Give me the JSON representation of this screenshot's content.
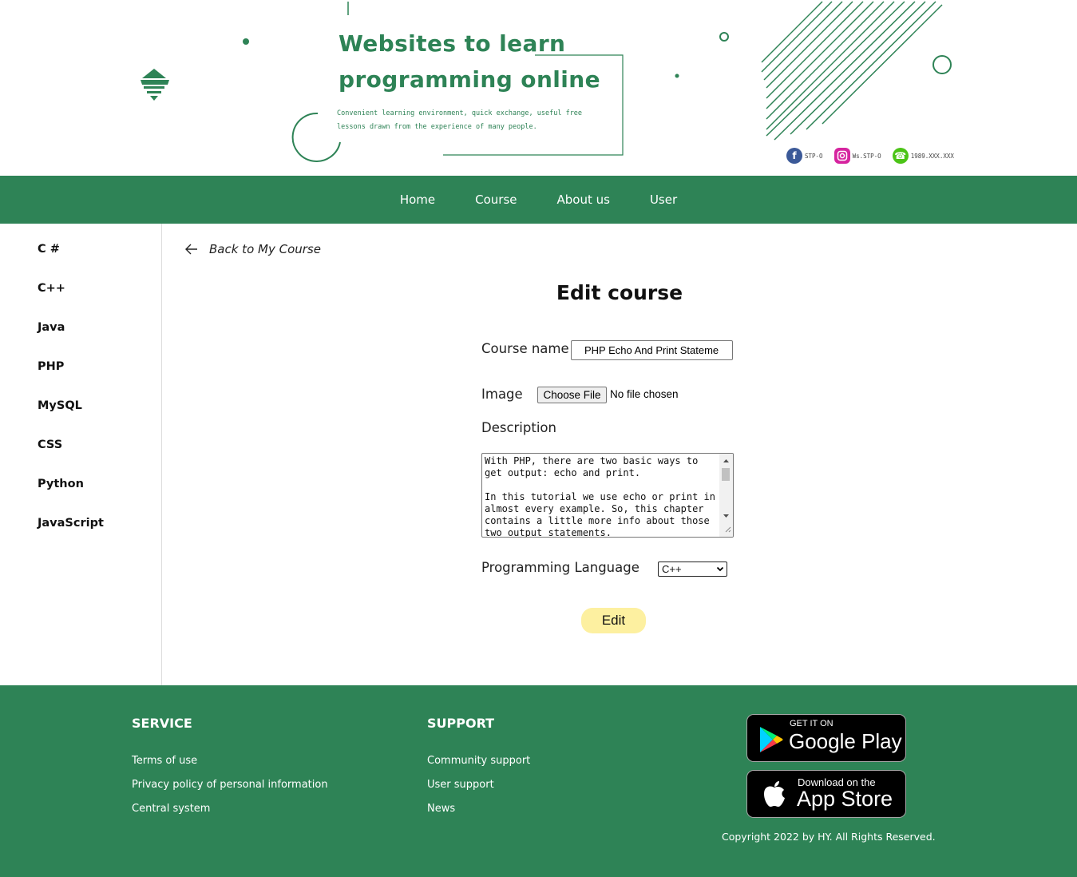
{
  "header": {
    "title_line1": "Websites to learn",
    "title_line2": "programming online",
    "subtitle": "Convenient learning environment, quick exchange, useful free lessons drawn from the experience of many people.",
    "socials": [
      {
        "icon": "facebook-icon",
        "text": "STP-O",
        "color": "#3b5998"
      },
      {
        "icon": "instagram-icon",
        "text": "Ws.STP-O",
        "color": "#d6249f"
      },
      {
        "icon": "phone-icon",
        "text": "1989.XXX.XXX",
        "color": "#4cc417"
      }
    ]
  },
  "nav": {
    "items": [
      "Home",
      "Course",
      "About us",
      "User"
    ]
  },
  "sidebar": {
    "items": [
      "C #",
      "C++",
      "Java",
      "PHP",
      "MySQL",
      "CSS",
      "Python",
      "JavaScript"
    ]
  },
  "main": {
    "back_label": "Back to My Course",
    "title": "Edit course",
    "course_name_label": "Course name",
    "course_name_value": "PHP Echo And Print Stateme",
    "image_label": "Image",
    "file_button": "Choose File",
    "file_status": "No file chosen",
    "description_label": "Description",
    "description_value": "With PHP, there are two basic ways to get output: echo and print.\n\nIn this tutorial we use echo or print in almost every example. So, this chapter contains a little more info about those two output statements.",
    "language_label": "Programming Language",
    "language_selected": "C++",
    "edit_button": "Edit"
  },
  "footer": {
    "service_title": "SERVICE",
    "service_links": [
      "Terms of use",
      "Privacy policy of personal information",
      "Central system"
    ],
    "support_title": "SUPPORT",
    "support_links": [
      "Community support",
      "User support",
      "News"
    ],
    "google_play": {
      "small": "GET IT ON",
      "big": "Google Play"
    },
    "app_store": {
      "small": "Download on the",
      "big": "App Store"
    },
    "copyright": "Copyright 2022 by HY. All Rights Reserved."
  },
  "colors": {
    "brand_green": "#2e8356",
    "edit_button_bg": "#fdf0a0"
  }
}
